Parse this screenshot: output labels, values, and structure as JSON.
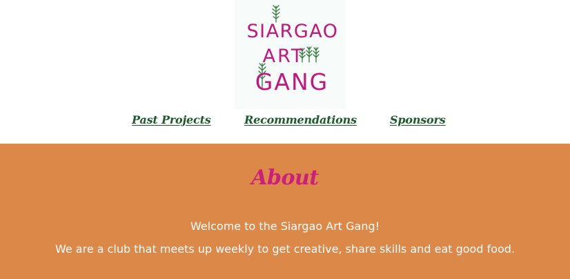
{
  "logo": {
    "line1": "SIARGAO",
    "line2": "ART",
    "line3": "GANG",
    "colors": {
      "text": "#c2167f",
      "leaves": "#2f7a3a",
      "background": "#f7fbfa"
    }
  },
  "nav": {
    "items": [
      {
        "label": "Past Projects"
      },
      {
        "label": "Recommendations"
      },
      {
        "label": "Sponsors"
      }
    ],
    "color": "#1f5a2c"
  },
  "about": {
    "title": "About",
    "welcome": "Welcome to the Siargao Art Gang!",
    "description": "We are a club that meets up weekly to get creative, share skills and eat good food.",
    "colors": {
      "background": "#db8848",
      "title": "#cc1f7b",
      "text": "#ffffff"
    }
  }
}
